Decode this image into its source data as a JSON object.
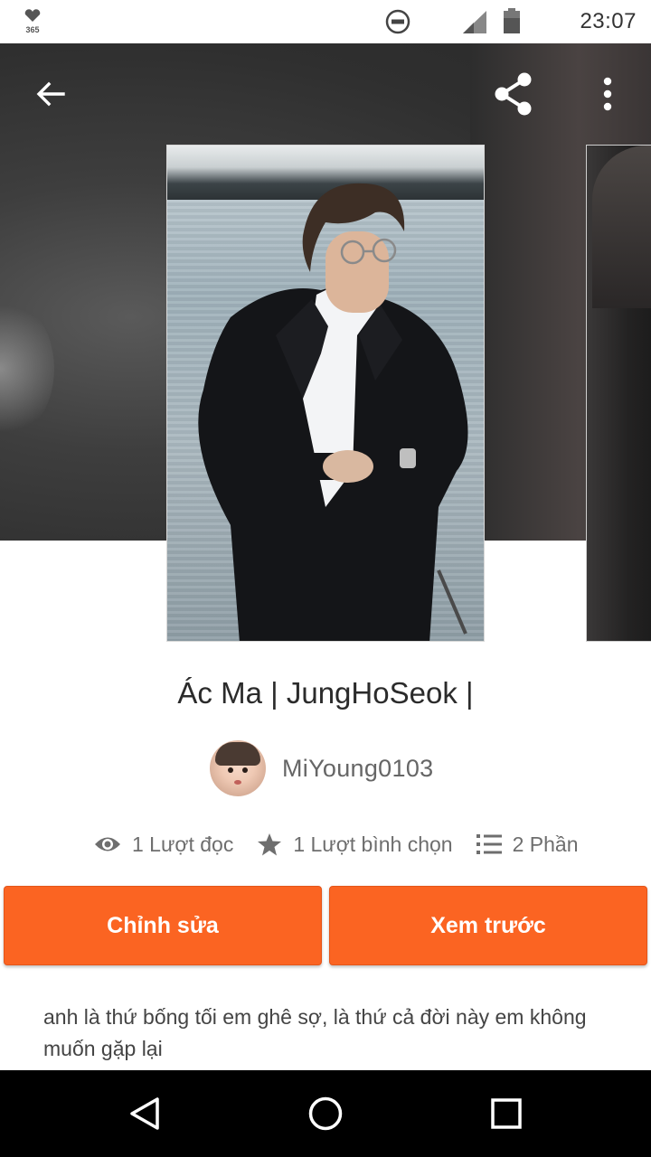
{
  "status_bar": {
    "app_badge_text": "365",
    "time": "23:07",
    "icons": [
      "heart-365-app-icon",
      "do-not-disturb-icon",
      "signal-icon",
      "battery-icon"
    ]
  },
  "toolbar": {
    "icons": [
      "back-arrow-icon",
      "share-icon",
      "more-vert-icon"
    ]
  },
  "story": {
    "title": "Ác Ma | JungHoSeok |",
    "author": "MiYoung0103",
    "stats": {
      "reads": "1 Lượt đọc",
      "votes": "1 Lượt bình chọn",
      "parts": "2 Phần"
    },
    "description": "anh là  thứ bống tối em ghê sợ, là thứ cả đời này em không muốn gặp lại"
  },
  "actions": {
    "edit_label": "Chỉnh sửa",
    "preview_label": "Xem trước"
  },
  "nav_bar": {
    "icons": [
      "nav-back-icon",
      "nav-home-icon",
      "nav-recent-icon"
    ]
  },
  "colors": {
    "accent": "#fb6422",
    "banner": "#3a3a3a",
    "nav_bar": "#000000"
  }
}
